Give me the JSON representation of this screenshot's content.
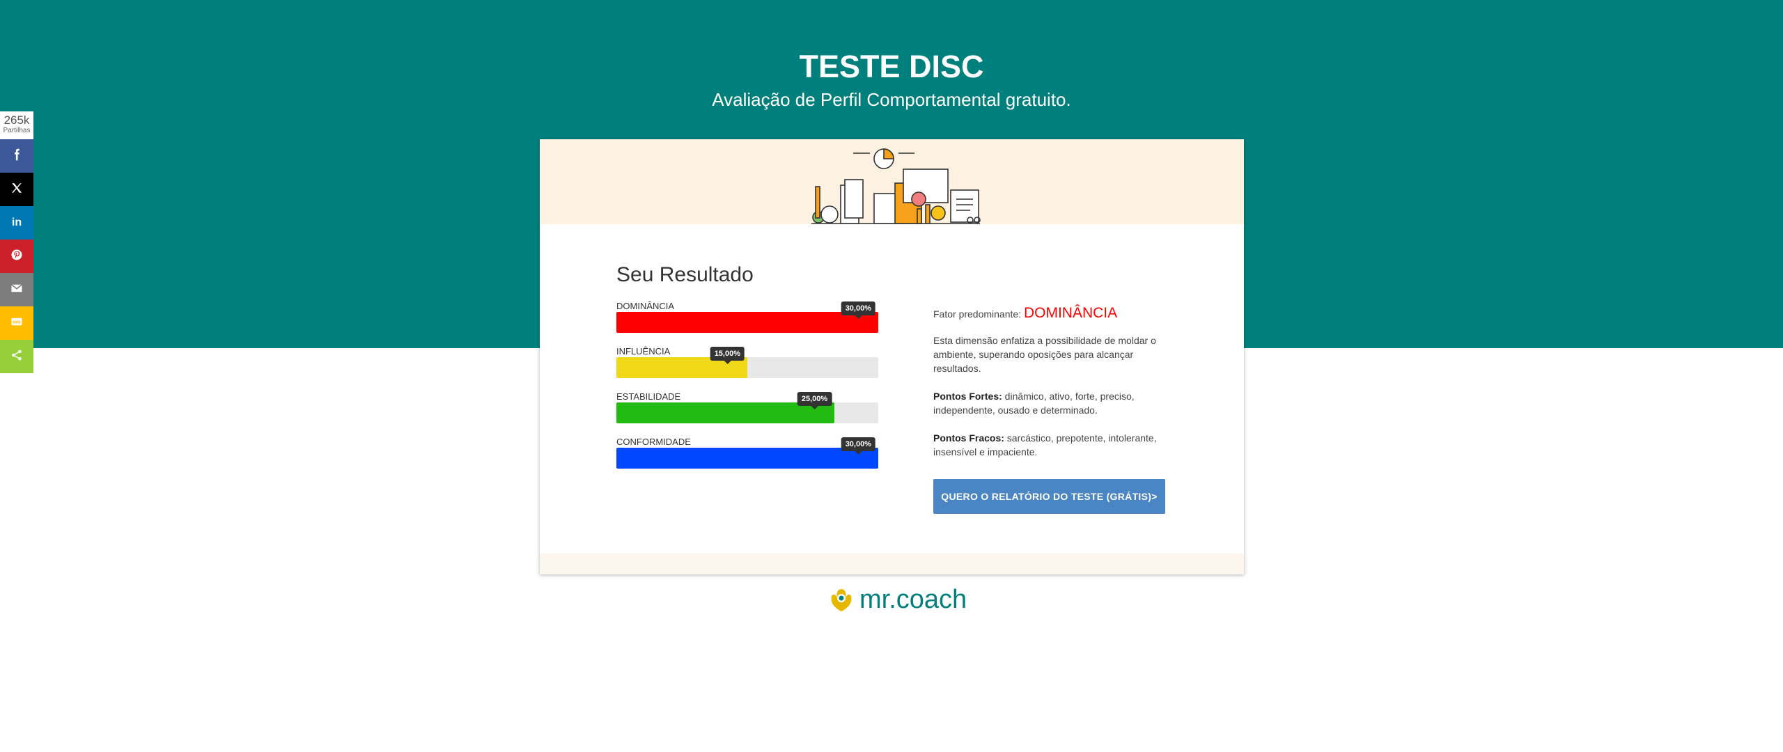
{
  "header": {
    "title": "TESTE DISC",
    "subtitle": "Avaliação de Perfil Comportamental gratuito."
  },
  "share": {
    "count": "265k",
    "count_label": "Partilhas",
    "buttons": [
      {
        "name": "facebook",
        "icon": "facebook-icon",
        "color": "#3b5998"
      },
      {
        "name": "x",
        "icon": "x-icon",
        "color": "#000000"
      },
      {
        "name": "linkedin",
        "icon": "linkedin-icon",
        "color": "#0077b5"
      },
      {
        "name": "pinterest",
        "icon": "pinterest-icon",
        "color": "#cb2027"
      },
      {
        "name": "email",
        "icon": "email-icon",
        "color": "#7d7d7d"
      },
      {
        "name": "sms",
        "icon": "sms-icon",
        "color": "#ffbd00"
      },
      {
        "name": "share",
        "icon": "share-icon",
        "color": "#95d03a"
      }
    ]
  },
  "result": {
    "title": "Seu Resultado",
    "bars": [
      {
        "label": "DOMINÂNCIA",
        "value_text": "30,00%",
        "fill_fraction": 1.0,
        "color": "#ff0000"
      },
      {
        "label": "INFLUÊNCIA",
        "value_text": "15,00%",
        "fill_fraction": 0.5,
        "color": "#eed817"
      },
      {
        "label": "ESTABILIDADE",
        "value_text": "25,00%",
        "fill_fraction": 0.833,
        "color": "#22bb11"
      },
      {
        "label": "CONFORMIDADE",
        "value_text": "30,00%",
        "fill_fraction": 1.0,
        "color": "#0047ff"
      }
    ]
  },
  "analysis": {
    "fator_label": "Fator predominante:",
    "fator_value": "DOMINÂNCIA",
    "description": "Esta dimensão enfatiza a possibilidade de moldar o ambiente, superando oposições para alcançar resultados.",
    "fortes_label": "Pontos Fortes:",
    "fortes_text": "dinâmico, ativo, forte, preciso, independente, ousado e determinado.",
    "fracos_label": "Pontos Fracos:",
    "fracos_text": "sarcástico, prepotente, intolerante, insensível e impaciente.",
    "cta_label": "QUERO O RELATÓRIO DO TESTE (GRÁTIS)>"
  },
  "logo": {
    "text": "mr.coach",
    "icon": "mrcoach-logo-icon"
  },
  "colors": {
    "brand": "#00807c",
    "cta": "#4a86c6",
    "card_top": "#fdf1e2"
  }
}
